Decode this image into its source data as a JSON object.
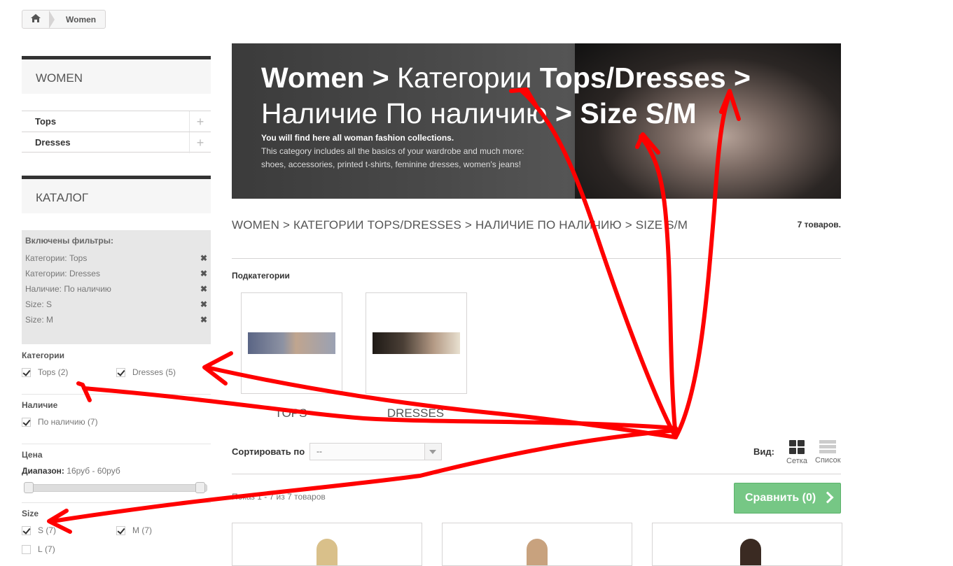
{
  "breadcrumb": {
    "home_icon": "home-icon",
    "current": "Women"
  },
  "sidebar": {
    "women_block": {
      "title": "WOMEN",
      "items": [
        {
          "label": "Tops"
        },
        {
          "label": "Dresses"
        }
      ]
    },
    "catalog_block": {
      "title": "КАТАЛОГ"
    },
    "active_filters": {
      "title": "Включены фильтры:",
      "items": [
        {
          "label": "Категории: Tops"
        },
        {
          "label": "Категории: Dresses"
        },
        {
          "label": "Наличие: По наличию"
        },
        {
          "label": "Size: S"
        },
        {
          "label": "Size: M"
        }
      ]
    },
    "categories": {
      "title": "Категории",
      "options": [
        {
          "label": "Tops",
          "count": "(2)",
          "checked": true
        },
        {
          "label": "Dresses",
          "count": "(5)",
          "checked": true
        }
      ]
    },
    "availability": {
      "title": "Наличие",
      "options": [
        {
          "label": "По наличию",
          "count": "(7)",
          "checked": true
        }
      ]
    },
    "price": {
      "title": "Цена",
      "range_label": "Диапазон:",
      "range_value": "16руб - 60руб"
    },
    "size": {
      "title": "Size",
      "options": [
        {
          "label": "S",
          "count": "(7)",
          "checked": true
        },
        {
          "label": "M",
          "count": "(7)",
          "checked": true
        },
        {
          "label": "L",
          "count": "(7)",
          "checked": false
        }
      ]
    }
  },
  "banner": {
    "title_part1": "Women > ",
    "title_part2": "Категории ",
    "title_part3": "Tops/Dresses > ",
    "title_part4": "Наличие По наличию",
    "title_part5": " > Size S/M",
    "subtitle": "You will find here all woman fashion collections.",
    "description_line1": "This category includes all the basics of your wardrobe and much more:",
    "description_line2": "shoes, accessories, printed t-shirts, feminine dresses, women's jeans!"
  },
  "heading": {
    "text": "WOMEN > КАТЕГОРИИ TOPS/DRESSES > НАЛИЧИЕ ПО НАЛИЧИЮ > SIZE S/M",
    "count": "7 товаров."
  },
  "subcategories": {
    "title": "Подкатегории",
    "items": [
      {
        "name": "TOPS"
      },
      {
        "name": "DRESSES"
      }
    ]
  },
  "toolbar": {
    "sort_label": "Сортировать по",
    "sort_value": "--",
    "view_label": "Вид:",
    "grid_label": "Сетка",
    "list_label": "Список",
    "showing": "Показ 1 - 7 из 7 товаров",
    "compare_label": "Сравнить (0)"
  },
  "colors": {
    "compare_button": "#76c785",
    "annotation": "#ff0000",
    "block_border": "#333333"
  }
}
